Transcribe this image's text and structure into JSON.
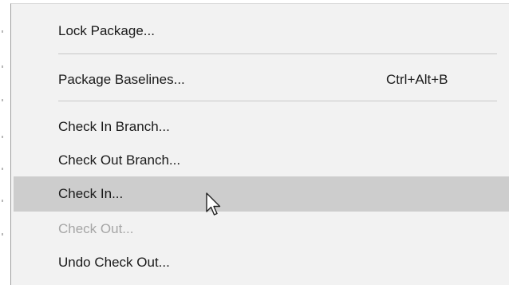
{
  "menu": {
    "items": [
      {
        "label": "Lock Package...",
        "shortcut": "",
        "enabled": true
      },
      {
        "label": "Package Baselines...",
        "shortcut": "Ctrl+Alt+B",
        "enabled": true
      },
      {
        "label": "Check In Branch...",
        "shortcut": "",
        "enabled": true
      },
      {
        "label": "Check Out Branch...",
        "shortcut": "",
        "enabled": true
      },
      {
        "label": "Check In...",
        "shortcut": "",
        "enabled": true,
        "hovered": true
      },
      {
        "label": "Check Out...",
        "shortcut": "",
        "enabled": false
      },
      {
        "label": "Undo Check Out...",
        "shortcut": "",
        "enabled": true
      }
    ]
  },
  "colors": {
    "menu_background": "#f2f2f2",
    "hover_background": "#cdcdcd",
    "text": "#1a1a1a",
    "disabled_text": "#a6a6a6",
    "separator": "#c8c8c8"
  },
  "cursor": {
    "icon": "arrow-pointer-icon"
  }
}
